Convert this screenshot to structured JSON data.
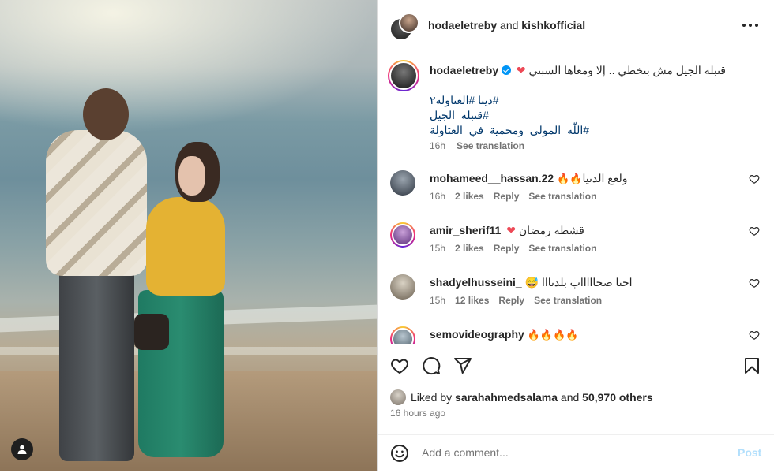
{
  "header": {
    "user1": "hodaeletreby",
    "and_text": " and ",
    "user2": "kishkofficial"
  },
  "caption": {
    "username": "hodaeletreby",
    "text": "قنبلة الجيل مش بتخطي .. إلا ومعاها السبتي",
    "hashtags": [
      "#دينا #العتاولة٢",
      "#قنبلة_الجيل",
      "#اللّه_المولى_ومحمية_في_العتاولة"
    ],
    "time": "16h",
    "see_translation": "See translation"
  },
  "comments": [
    {
      "username": "mohameed__hassan.22",
      "text": "ولعع الدنيا",
      "emoji": "🔥🔥",
      "time": "16h",
      "likes": "2 likes",
      "reply": "Reply",
      "see_translation": "See translation"
    },
    {
      "username": "amir_sherif11",
      "text": "قشطه رمضان",
      "emoji": "❤",
      "time": "15h",
      "likes": "2 likes",
      "reply": "Reply",
      "see_translation": "See translation"
    },
    {
      "username": "shadyelhusseini_",
      "text": "احنا صحاااااب بلدنااا",
      "emoji": "😅",
      "time": "15h",
      "likes": "12 likes",
      "reply": "Reply",
      "see_translation": "See translation"
    },
    {
      "username": "semovideography",
      "text": "",
      "emoji": "🔥🔥🔥🔥",
      "time": "",
      "likes": "",
      "reply": "",
      "see_translation": ""
    }
  ],
  "actions": {
    "liked_by_prefix": "Liked by ",
    "liked_by_user": "sarahahmedsalama",
    "and_text": " and ",
    "others": "50,970 others",
    "time_ago": "16 hours ago"
  },
  "add_comment": {
    "placeholder": "Add a comment...",
    "post_label": "Post"
  },
  "icons": [
    "user-tag-icon",
    "more-options-icon",
    "verified-icon",
    "like-icon",
    "comment-icon",
    "share-icon",
    "save-icon",
    "emoji-icon",
    "comment-like-icon"
  ],
  "colors": {
    "link": "#00376b",
    "verified": "#0095f6",
    "post_disabled": "#b2dffc",
    "heart": "#ed4956"
  }
}
